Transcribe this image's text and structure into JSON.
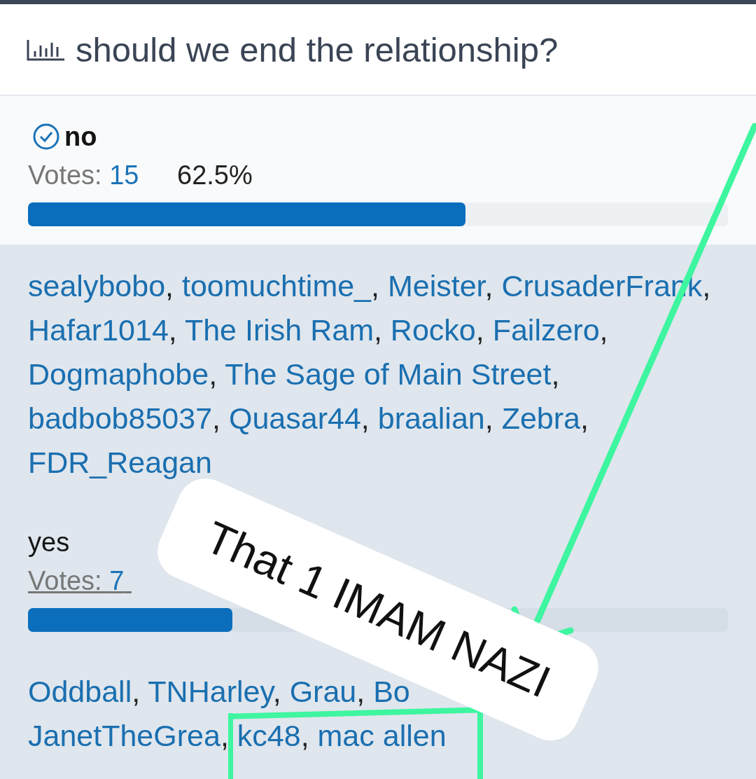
{
  "poll": {
    "title": "should we end the relationship?"
  },
  "options": [
    {
      "label": "no",
      "selected": true,
      "votes_label": "Votes:",
      "votes": "15",
      "percent": "62.5%",
      "level": 0.625,
      "voter_lines": [
        [
          {
            "name": "sealybobo",
            "sep": ","
          },
          {
            "name": "toomuchtime_",
            "sep": ","
          },
          {
            "name": "Meister",
            "sep": ","
          },
          {
            "name": "CrusaderFrank",
            "sep": ","
          }
        ],
        [
          {
            "name": "Hafar1014",
            "sep": ","
          },
          {
            "name": "The Irish Ram",
            "sep": ","
          },
          {
            "name": "Rocko",
            "sep": ","
          },
          {
            "name": "Failzero",
            "sep": ","
          }
        ],
        [
          {
            "name": "Dogmaphobe",
            "sep": ","
          },
          {
            "name": "The Sage of Main Street",
            "sep": ","
          }
        ],
        [
          {
            "name": "badbob85037",
            "sep": ","
          },
          {
            "name": "Quasar44",
            "sep": ","
          },
          {
            "name": "braalian",
            "sep": ","
          },
          {
            "name": "Zebra",
            "sep": ","
          }
        ],
        [
          {
            "name": "FDR_Reagan"
          }
        ]
      ]
    },
    {
      "label": "yes",
      "selected": false,
      "votes_label": "Votes:",
      "votes": "7",
      "level": 0.2917,
      "voter_lines": [
        [
          {
            "name": "Oddball",
            "sep": ","
          },
          {
            "name": "TNHarley",
            "sep": ","
          },
          {
            "name": "Grau",
            "sep": ","
          },
          {
            "name": "Bo"
          }
        ],
        [
          {
            "name": "JanetTheGrea",
            "sep": ","
          },
          {
            "name": "kc48",
            "sep": ","
          },
          {
            "name": "mac allen"
          }
        ]
      ]
    }
  ],
  "sticker": {
    "text": "That 1 IMAM NAZI"
  }
}
